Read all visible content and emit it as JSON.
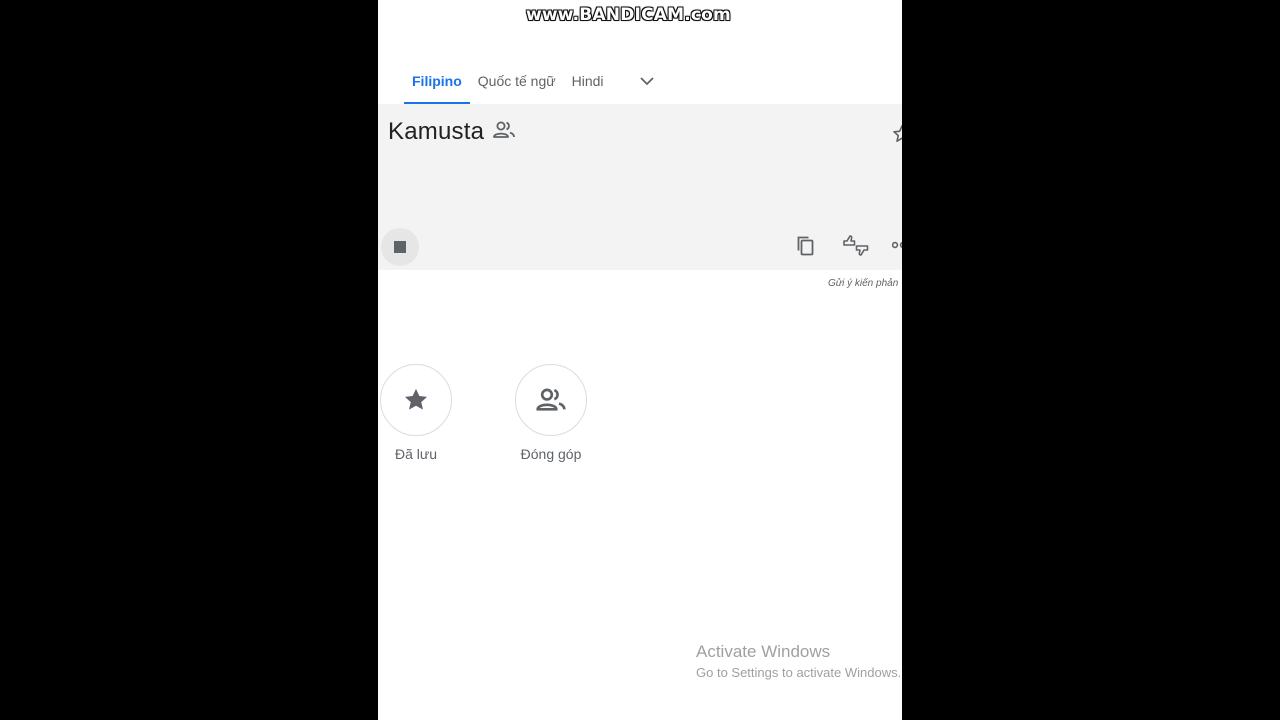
{
  "watermark": "www.BANDICAM.com",
  "tabs": [
    {
      "label": "Filipino",
      "active": true
    },
    {
      "label": "Quốc tế ngữ",
      "active": false
    },
    {
      "label": "Hindi",
      "active": false
    }
  ],
  "result": {
    "text": "Kamusta",
    "feedback": "Gửi ý kiến phản"
  },
  "actions": {
    "saved": "Đã lưu",
    "contribute": "Đóng góp"
  },
  "activation": {
    "title": "Activate Windows",
    "subtitle": "Go to Settings to activate Windows."
  },
  "colors": {
    "accent": "#1a73e8",
    "card_bg": "#f3f3f3",
    "icon": "#5f6368"
  }
}
